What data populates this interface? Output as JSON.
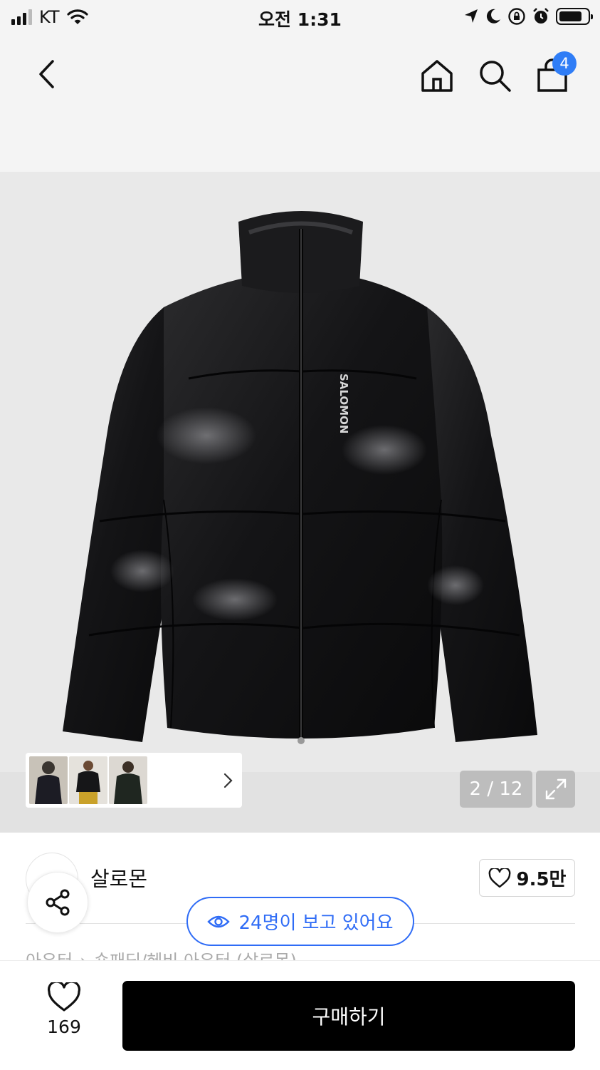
{
  "status_bar": {
    "carrier": "KT",
    "time": "오전 1:31",
    "icons": [
      "signal-icon",
      "wifi-icon",
      "location-arrow-icon",
      "moon-icon",
      "rotation-lock-icon",
      "alarm-icon",
      "battery-icon"
    ],
    "battery_level": 0.7
  },
  "header": {
    "back_icon": "chevron-left-icon",
    "home_icon": "home-icon",
    "search_icon": "search-icon",
    "bag_icon": "shopping-bag-icon",
    "cart_count": "4"
  },
  "gallery": {
    "counter": "2 / 12",
    "current_index": 2,
    "total": 12,
    "thumbnails": [
      "thumbnail-1",
      "thumbnail-2",
      "thumbnail-3"
    ],
    "product_logo_text": "SALOMON"
  },
  "brand": {
    "name": "살로몬",
    "likes": "9.5만"
  },
  "viewers": {
    "text": "24명이 보고 있어요"
  },
  "breadcrumb": [
    "아우터",
    "숏패딩/헤비 아우터 (살로몬)"
  ],
  "bottom_bar": {
    "wishlist_count": "169",
    "buy_label": "구매하기"
  },
  "colors": {
    "accent": "#2f6cf6",
    "badge": "#2f7df6",
    "buy_button": "#000000",
    "background_gray": "#f4f4f4"
  }
}
